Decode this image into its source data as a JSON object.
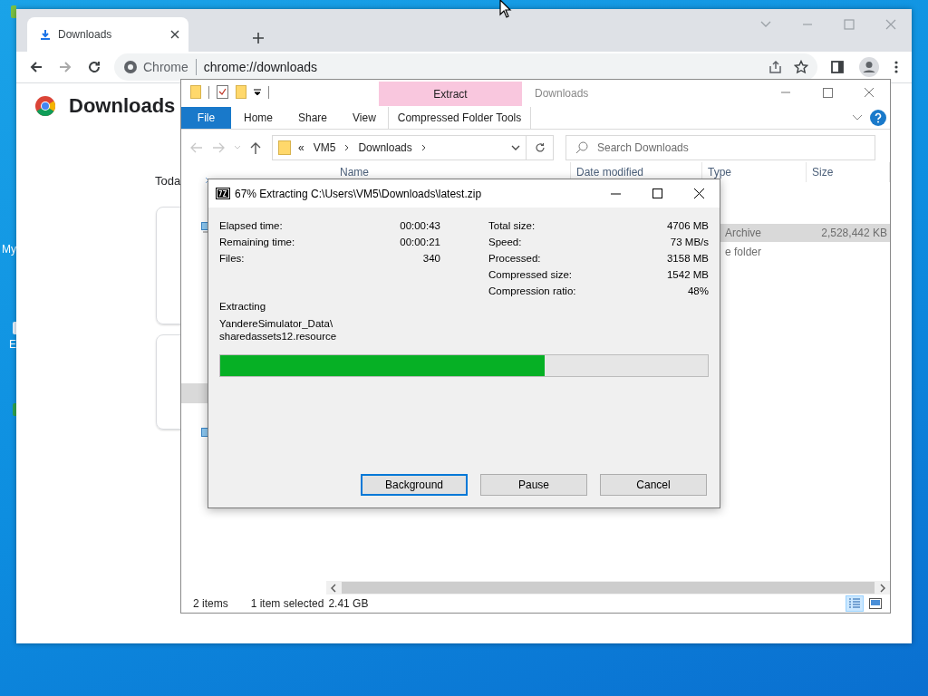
{
  "desktop": {
    "icon_labels": [
      "My",
      "E"
    ]
  },
  "browser": {
    "tab": {
      "title": "Downloads",
      "selected": true
    },
    "omnibox": {
      "chip": "Chrome",
      "url": "chrome://downloads"
    },
    "page": {
      "title": "Downloads",
      "section_heading": "Toda"
    }
  },
  "explorer": {
    "contextual_tab": "Extract",
    "title": "Downloads",
    "ribbon_tabs": [
      {
        "label": "File",
        "kind": "file"
      },
      {
        "label": "Home",
        "kind": "tab"
      },
      {
        "label": "Share",
        "kind": "tab"
      },
      {
        "label": "View",
        "kind": "tab"
      },
      {
        "label": "Compressed Folder Tools",
        "kind": "context"
      }
    ],
    "breadcrumb": {
      "overflow": "«",
      "parts": [
        "VM5",
        "Downloads"
      ]
    },
    "search": {
      "placeholder": "Search Downloads"
    },
    "columns": [
      "Name",
      "Date modified",
      "Type",
      "Size"
    ],
    "rows": [
      {
        "type": "Archive",
        "size": "2,528,442 KB",
        "selected": true
      },
      {
        "type": "e folder",
        "selected": false
      }
    ],
    "status_bar": {
      "item_count": "2 items",
      "selection": "1 item selected",
      "selection_size": "2.41 GB"
    },
    "view_buttons": [
      {
        "kind": "details",
        "selected": true
      },
      {
        "kind": "large-icons",
        "selected": false
      }
    ]
  },
  "extract_dialog": {
    "title": "67% Extracting C:\\Users\\VM5\\Downloads\\latest.zip",
    "left_stats": [
      {
        "label": "Elapsed time:",
        "value": "00:00:43"
      },
      {
        "label": "Remaining time:",
        "value": "00:00:21"
      },
      {
        "label": "Files:",
        "value": "340"
      }
    ],
    "right_stats": [
      {
        "label": "Total size:",
        "value": "4706 MB"
      },
      {
        "label": "Speed:",
        "value": "73 MB/s"
      },
      {
        "label": "Processed:",
        "value": "3158 MB"
      },
      {
        "label": "Compressed size:",
        "value": "1542 MB"
      },
      {
        "label": "Compression ratio:",
        "value": "48%"
      }
    ],
    "status": "Extracting",
    "current_file": [
      "YandereSimulator_Data\\",
      "sharedassets12.resource"
    ],
    "progress": {
      "level": 0.665
    },
    "buttons": [
      {
        "label": "Background",
        "focused": true
      },
      {
        "label": "Pause",
        "focused": false
      },
      {
        "label": "Cancel",
        "focused": false
      }
    ]
  }
}
